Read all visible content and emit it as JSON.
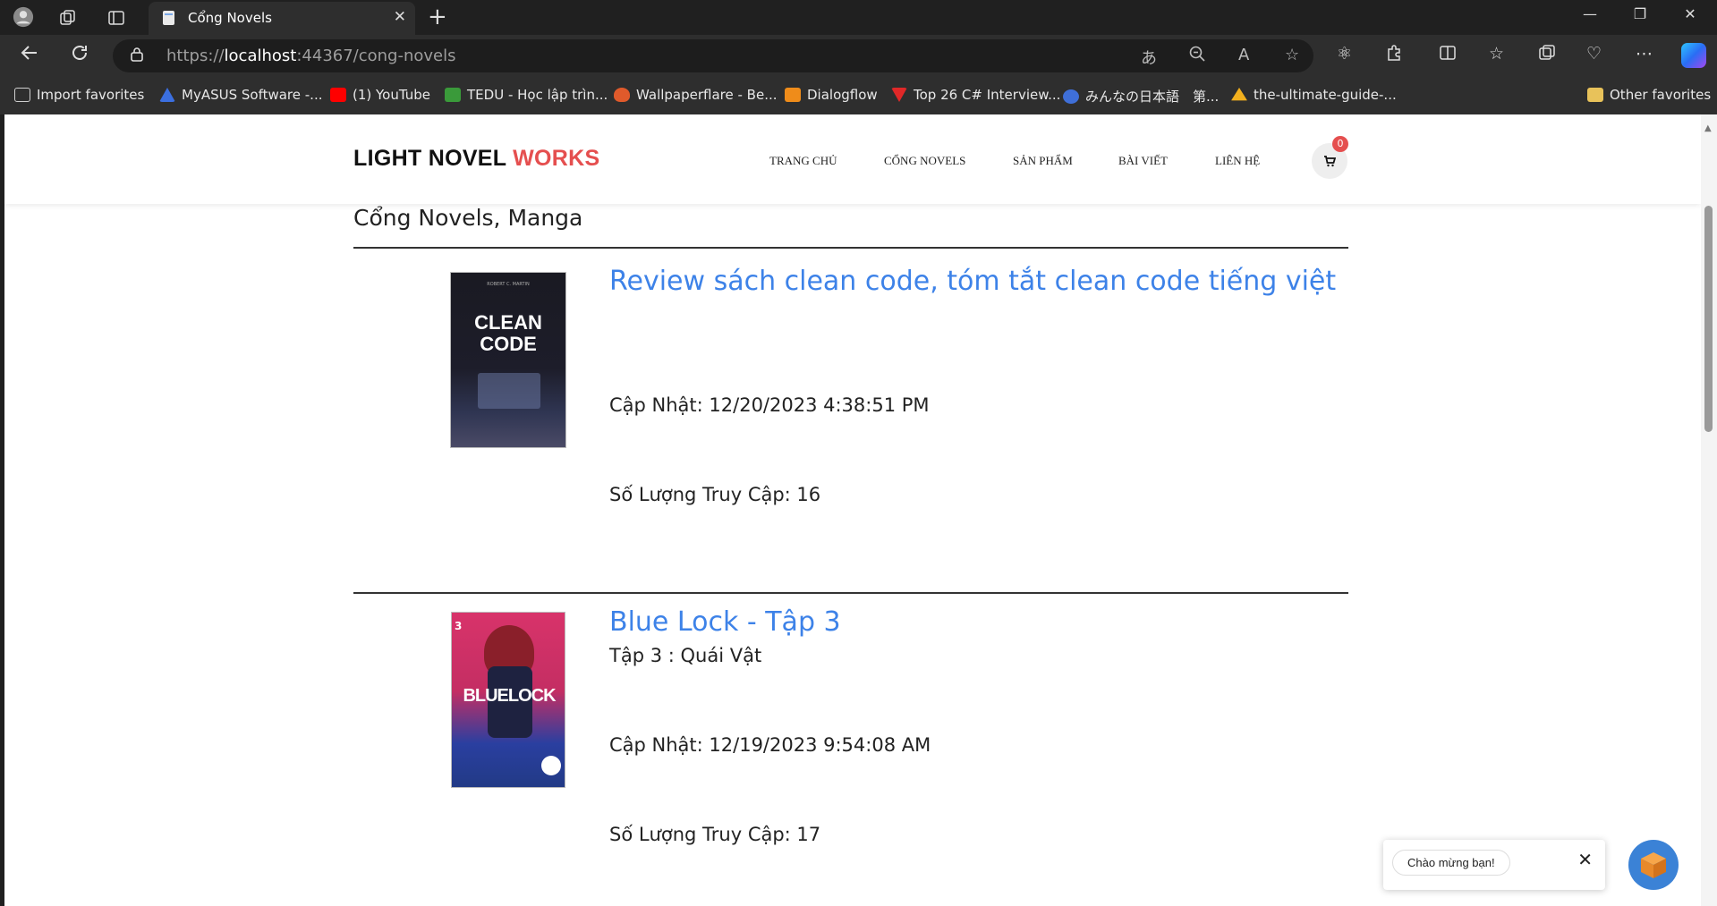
{
  "browser": {
    "tab_title": "Cổng Novels",
    "tab_close": "✕",
    "new_tab": "+",
    "url_host": "localhost",
    "url_prefix": "https://",
    "url_rest": ":44367/cong-novels",
    "favorites": [
      {
        "label": "Import favorites",
        "icon": "import-icon",
        "color": "#cfcfcf"
      },
      {
        "label": "MyASUS Software -...",
        "icon": "asus-icon",
        "color": "#3b6fe0"
      },
      {
        "label": "(1) YouTube",
        "icon": "youtube-icon",
        "color": "#ff0000"
      },
      {
        "label": "TEDU - Học lập trìn...",
        "icon": "tedu-icon",
        "color": "#3a9a3a"
      },
      {
        "label": "Wallpaperflare - Be...",
        "icon": "wallpaperflare-icon",
        "color": "#e05a2b"
      },
      {
        "label": "Dialogflow",
        "icon": "dialogflow-icon",
        "color": "#ef8c1a"
      },
      {
        "label": "Top 26 C# Interview...",
        "icon": "interview-icon",
        "color": "#e02828"
      },
      {
        "label": "みんなの日本語　第...",
        "icon": "minna-icon",
        "color": "#3f6fd8"
      },
      {
        "label": "the-ultimate-guide-...",
        "icon": "drive-icon",
        "color": "#f2b01e"
      }
    ],
    "other_favorites": "Other favorites"
  },
  "site": {
    "logo_main": "LIGHT NOVEL ",
    "logo_accent": "WORKS",
    "menu": [
      "TRANG CHỦ",
      "CỔNG NOVELS",
      "SẢN PHẨM",
      "BÀI VIẾT",
      "LIÊN HỆ"
    ],
    "cart_count": "0",
    "cart_icon": "🛒"
  },
  "page": {
    "heading": "Cổng Novels, Manga"
  },
  "posts": [
    {
      "title": "Review sách clean code, tóm tắt clean code tiếng việt",
      "subtitle": "",
      "updated": "Cập Nhật: 12/20/2023 4:38:51 PM",
      "views": "Số Lượng Truy Cập: 16",
      "cover_text_1": "CLEAN",
      "cover_text_2": "CODE"
    },
    {
      "title": "Blue Lock - Tập 3",
      "subtitle": "Tập 3 : Quái Vật",
      "updated": "Cập Nhật: 12/19/2023 9:54:08 AM",
      "views": "Số Lượng Truy Cập: 17",
      "cover_text_1": "BLUELOCK",
      "cover_text_2": "3"
    }
  ],
  "chat": {
    "greeting": "Chào mừng bạn!",
    "close": "✕"
  }
}
